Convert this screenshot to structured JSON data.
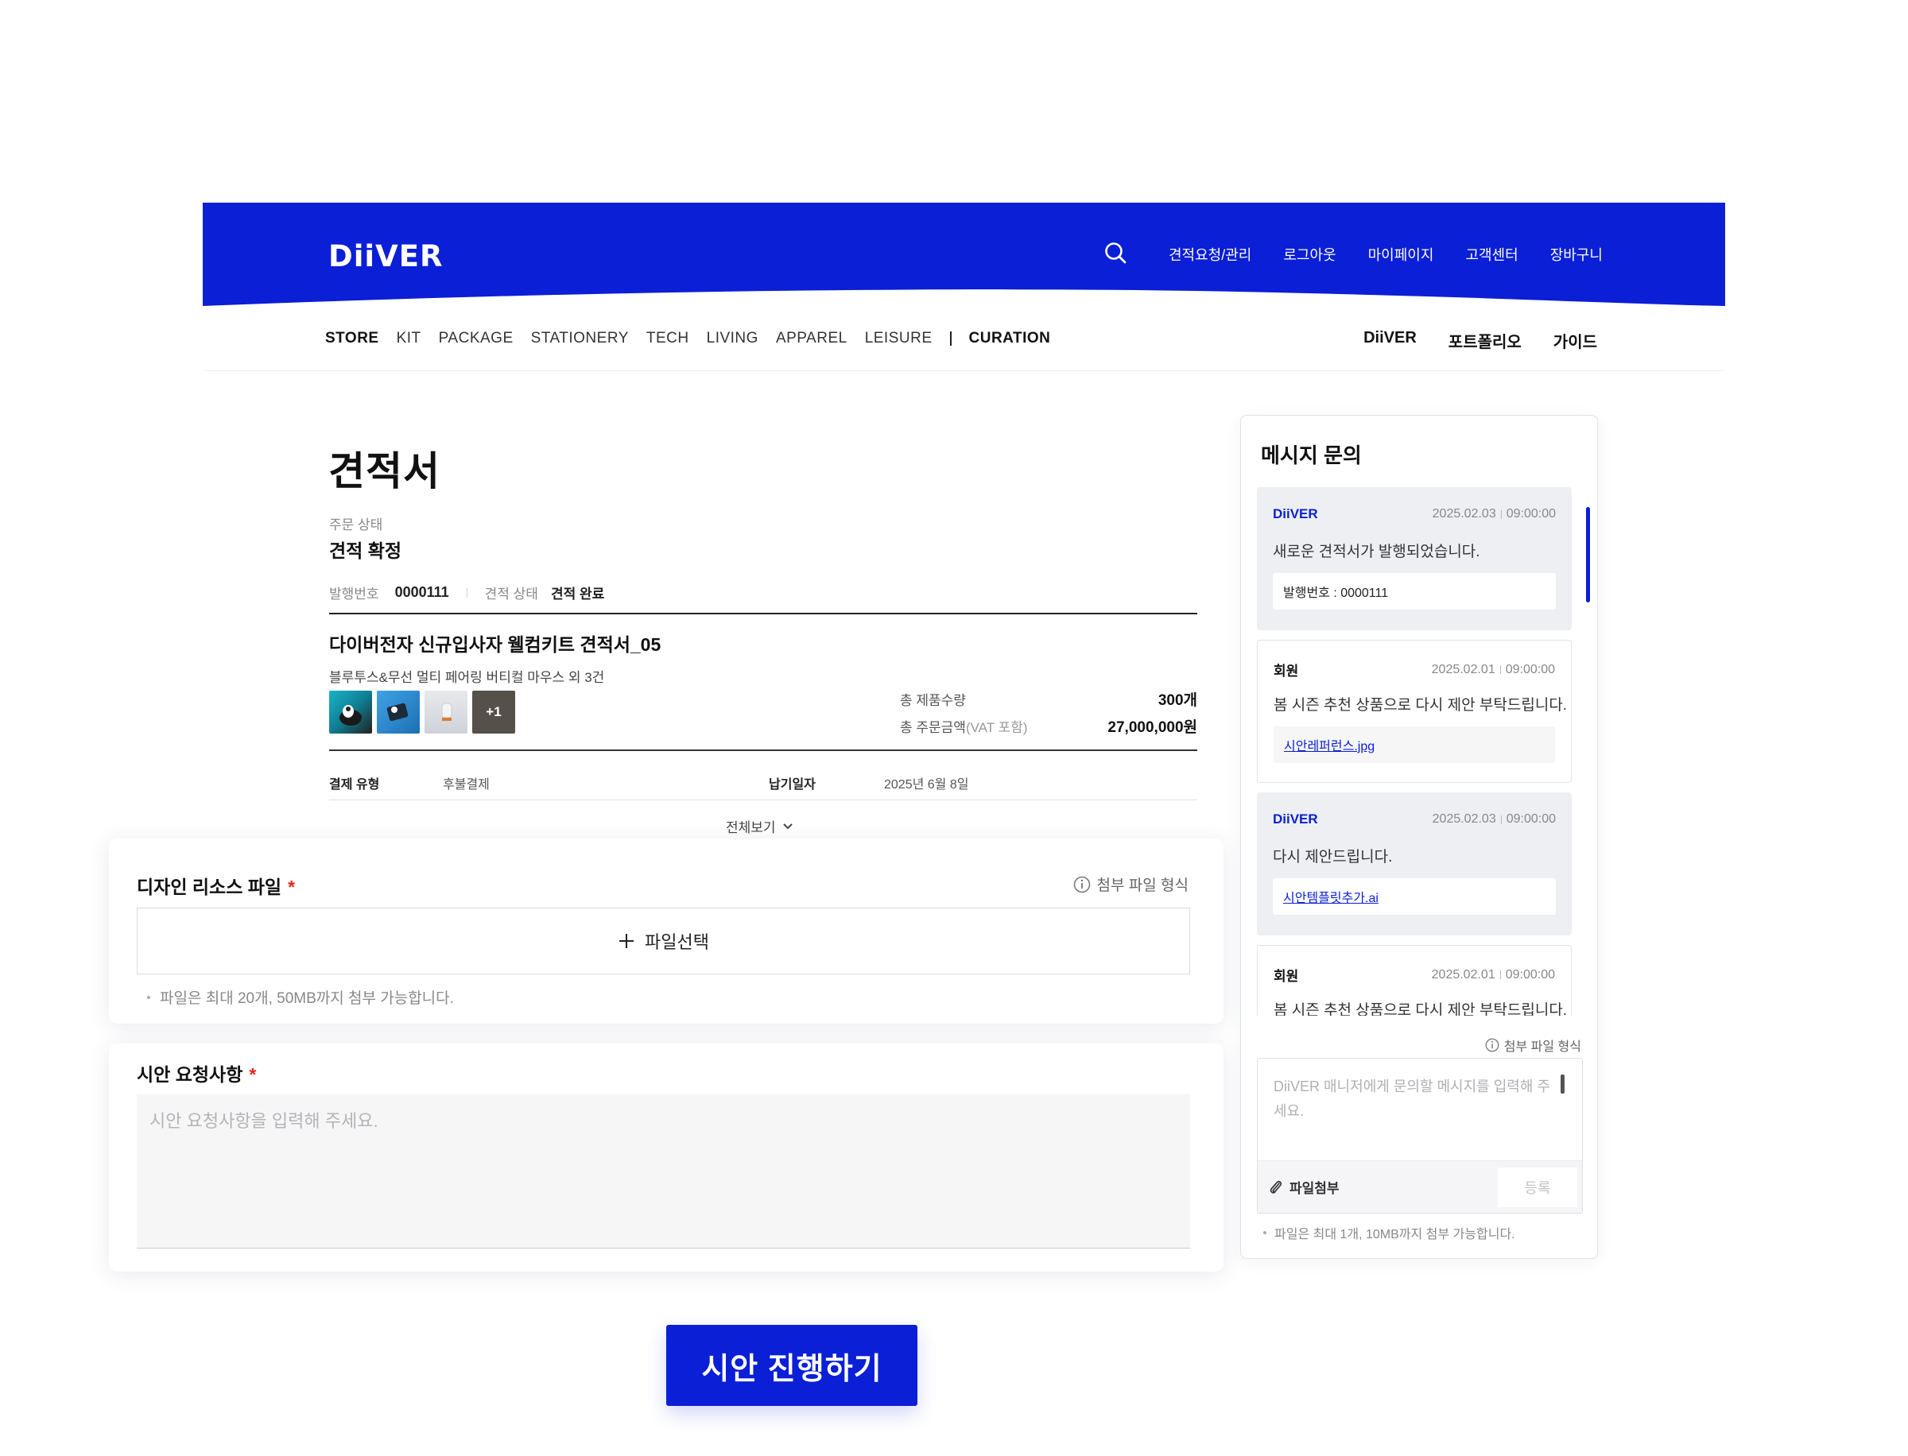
{
  "header": {
    "logo": "DiiVER",
    "utility_nav": [
      "견적요청/관리",
      "로그아웃",
      "마이페이지",
      "고객센터",
      "장바구니"
    ]
  },
  "category_nav": {
    "items": [
      "STORE",
      "KIT",
      "PACKAGE",
      "STATIONERY",
      "TECH",
      "LIVING",
      "APPAREL",
      "LEISURE"
    ],
    "curation": "CURATION",
    "brand_links": [
      "DiiVER",
      "포트폴리오",
      "가이드"
    ]
  },
  "quote": {
    "title": "견적서",
    "status_label": "주문 상태",
    "status_value": "견적 확정",
    "issue_no_label": "발행번호",
    "issue_no": "0000111",
    "quote_status_label": "견적 상태",
    "quote_status": "견적 완료",
    "name": "다이버전자 신규입사자 웰컴키트 견적서_05",
    "items_summary": "블루투스&무선 멀티 페어링 버티컬 마우스 외 3건",
    "extra_thumbs": "+1",
    "total_qty_label": "총 제품수량",
    "total_qty": "300개",
    "total_amount_label": "총 주문금액",
    "vat_note": "(VAT 포함)",
    "total_amount": "27,000,000원",
    "payment_type_label": "결제 유형",
    "payment_type": "후불결제",
    "delivery_date_label": "납기일자",
    "delivery_date": "2025년 6월 8일",
    "view_all": "전체보기"
  },
  "design_files": {
    "title": "디자인 리소스 파일",
    "required_mark": "*",
    "format_link": "첨부 파일 형식",
    "select_label": "파일선택",
    "hint": "파일은 최대 20개, 50MB까지 첨부 가능합니다."
  },
  "draft_request": {
    "title": "시안 요청사항",
    "required_mark": "*",
    "placeholder": "시안 요청사항을 입력해 주세요."
  },
  "cta_label": "시안 진행하기",
  "messages": {
    "title": "메시지 문의",
    "list": [
      {
        "author": "DiiVER",
        "date": "2025.02.03",
        "time": "09:00:00",
        "text": "새로운 견적서가 발행되었습니다.",
        "attachment": "발행번호 : 0000111"
      },
      {
        "author": "회원",
        "date": "2025.02.01",
        "time": "09:00:00",
        "text": "봄 시즌 추천 상품으로 다시 제안 부탁드립니다.",
        "attachment": "시안레퍼런스.jpg"
      },
      {
        "author": "DiiVER",
        "date": "2025.02.03",
        "time": "09:00:00",
        "text": "다시 제안드립니다.",
        "attachment": "시안템플릿추가.ai"
      },
      {
        "author": "회원",
        "date": "2025.02.01",
        "time": "09:00:00",
        "text": "봄 시즌 추천 상품으로 다시 제안 부탁드립니다."
      }
    ],
    "format_link": "첨부 파일 형식",
    "input_placeholder": "DiiVER 매니저에게 문의할 메시지를 입력해 주세요.",
    "attach_label": "파일첨부",
    "submit_label": "등록",
    "hint": "파일은 최대 1개, 10MB까지 첨부 가능합니다."
  },
  "colors": {
    "brand_blue": "#0a1fd6",
    "required_red": "#e0261c"
  }
}
